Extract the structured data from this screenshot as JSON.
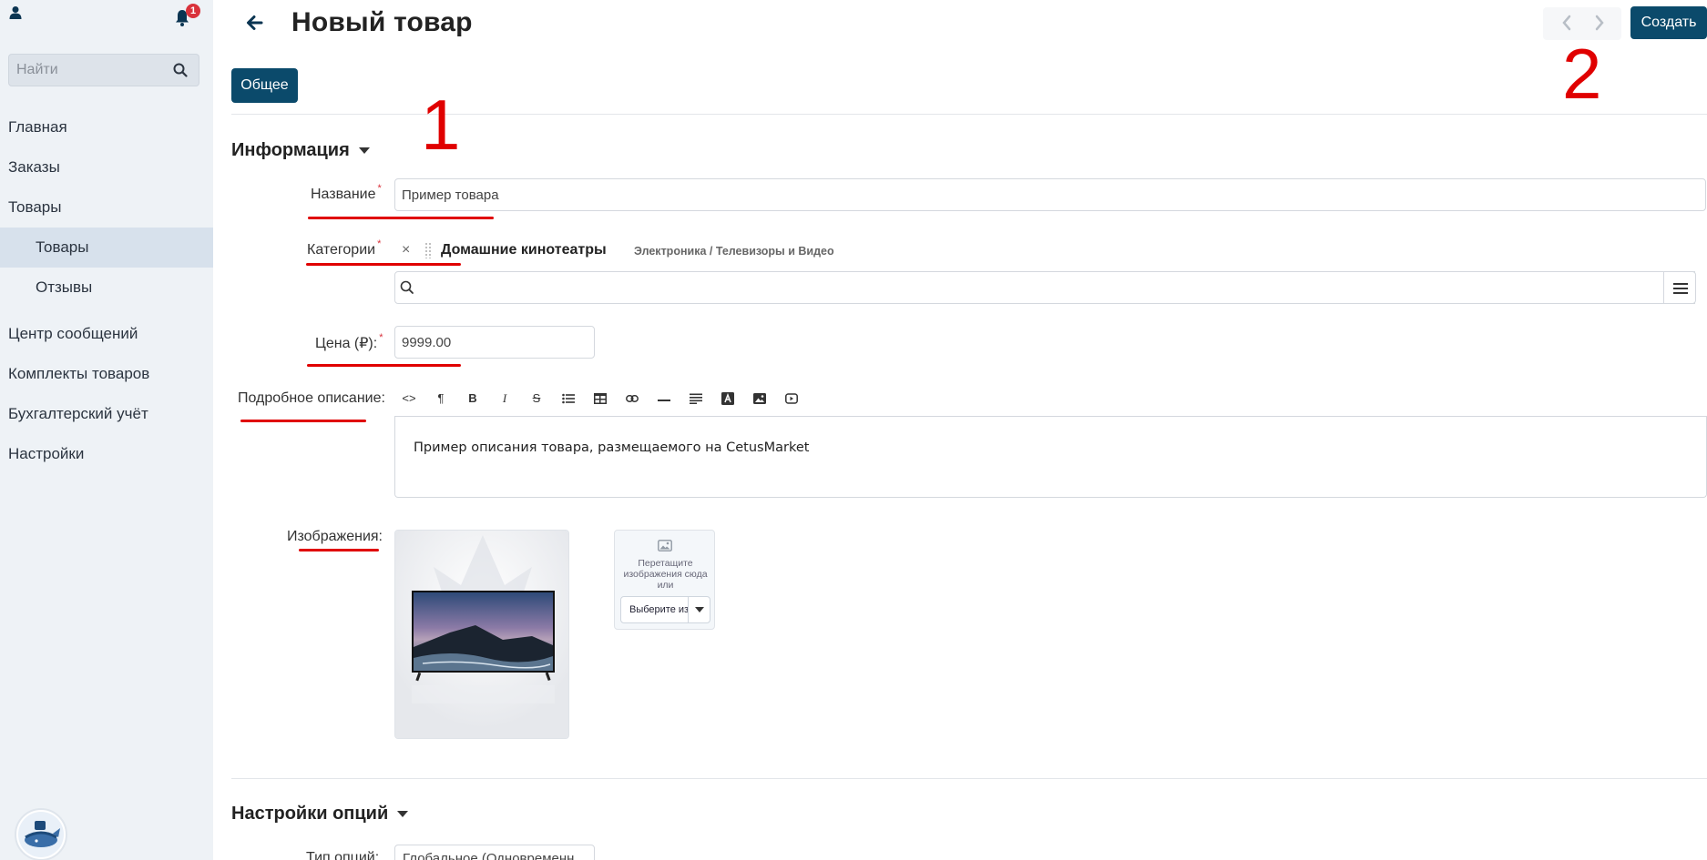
{
  "sidebar": {
    "notification_count": "1",
    "search_placeholder": "Найти",
    "items": [
      {
        "label": "Главная"
      },
      {
        "label": "Заказы"
      },
      {
        "label": "Товары"
      },
      {
        "label": "Товары"
      },
      {
        "label": "Отзывы"
      },
      {
        "label": "Центр сообщений"
      },
      {
        "label": "Комплекты товаров"
      },
      {
        "label": "Бухгалтерский учёт"
      },
      {
        "label": "Настройки"
      }
    ]
  },
  "header": {
    "title": "Новый товар",
    "create_label": "Создать"
  },
  "tabs": [
    {
      "label": "Общее",
      "active": true
    }
  ],
  "info_section": {
    "title": "Информация",
    "name_label": "Название",
    "name_value": "Пример товара",
    "categories_label": "Категории",
    "category_remove": "×",
    "category_name": "Домашние кинотеатры",
    "category_path": "Электроника / Телевизоры и Видео",
    "price_label": "Цена (₽):",
    "price_value": "9999.00",
    "description_label": "Подробное описание:",
    "description_text": "Пример описания товара, размещаемого на CetusMarket",
    "images_label": "Изображения:",
    "drop_text": "Перетащите изображения сюда или",
    "drop_select_label": "Выберите из"
  },
  "options_section": {
    "title": "Настройки опций",
    "type_label": "Тип опций:",
    "type_value": "Глобальное (Одновременн"
  },
  "toolbar_icons": [
    "code-icon",
    "paragraph-icon",
    "bold-icon",
    "italic-icon",
    "strikethrough-icon",
    "bullet-list-icon",
    "table-icon",
    "link-icon",
    "horizontal-rule-icon",
    "align-icon",
    "text-color-icon",
    "image-icon",
    "video-icon"
  ],
  "annotations": [
    "1",
    "2"
  ],
  "colors": {
    "primary": "#0b4a6b",
    "sidebar_bg": "#eef2f6",
    "sidebar_active": "#d7e1ec",
    "required": "#d9323b",
    "annotation": "#e00000"
  }
}
